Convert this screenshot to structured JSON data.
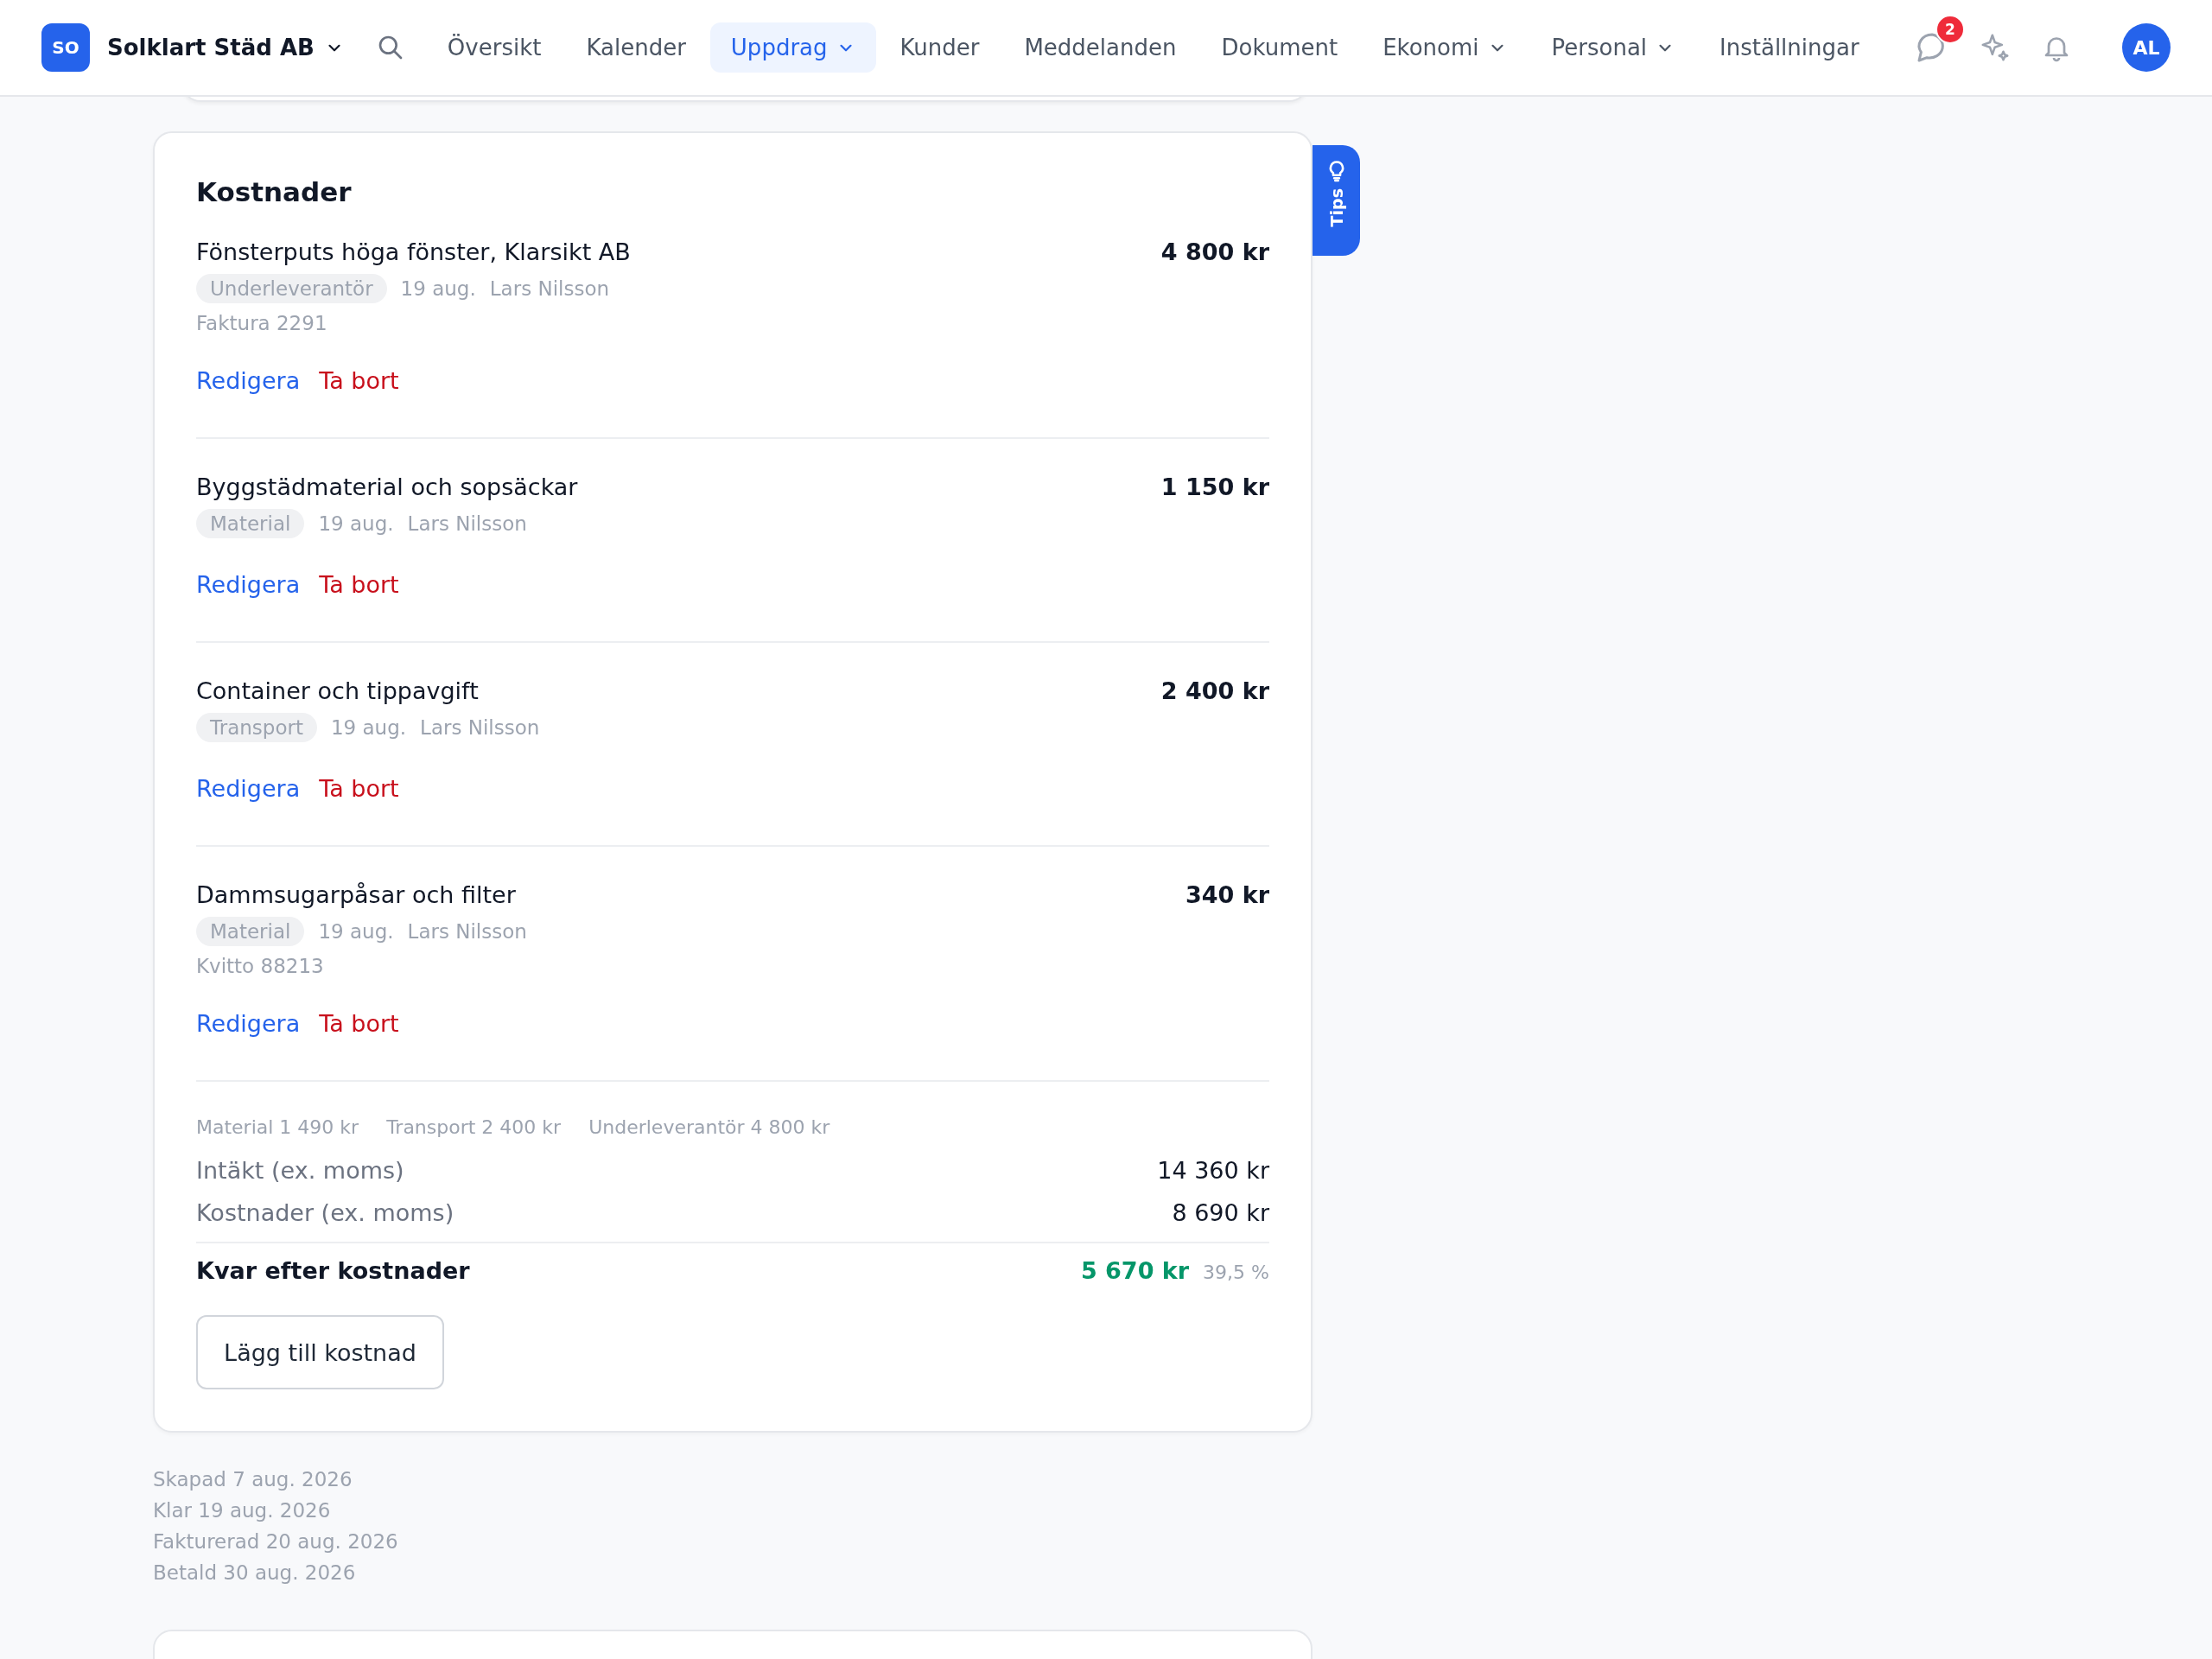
{
  "nav": {
    "logo": "SO",
    "company": "Solklart Städ AB",
    "items": [
      {
        "label": "Översikt",
        "selected": false,
        "dropdown": false
      },
      {
        "label": "Kalender",
        "selected": false,
        "dropdown": false
      },
      {
        "label": "Uppdrag",
        "selected": true,
        "dropdown": true
      },
      {
        "label": "Kunder",
        "selected": false,
        "dropdown": false
      },
      {
        "label": "Meddelanden",
        "selected": false,
        "dropdown": false
      },
      {
        "label": "Dokument",
        "selected": false,
        "dropdown": false
      },
      {
        "label": "Ekonomi",
        "selected": false,
        "dropdown": true
      },
      {
        "label": "Personal",
        "selected": false,
        "dropdown": true
      },
      {
        "label": "Inställningar",
        "selected": false,
        "dropdown": false
      }
    ],
    "message_badge": "2",
    "avatar": "AL"
  },
  "tips": "Tips",
  "costs": {
    "title": "Kostnader",
    "items": [
      {
        "title": "Fönsterputs höga fönster, Klarsikt AB",
        "amount": "4 800 kr",
        "category": "Underleverantör",
        "date": "19 aug.",
        "person": "Lars Nilsson",
        "note": "Faktura 2291",
        "edit": "Redigera",
        "delete": "Ta bort"
      },
      {
        "title": "Byggstädmaterial och sopsäckar",
        "amount": "1 150 kr",
        "category": "Material",
        "date": "19 aug.",
        "person": "Lars Nilsson",
        "edit": "Redigera",
        "delete": "Ta bort"
      },
      {
        "title": "Container och tippavgift",
        "amount": "2 400 kr",
        "category": "Transport",
        "date": "19 aug.",
        "person": "Lars Nilsson",
        "edit": "Redigera",
        "delete": "Ta bort"
      },
      {
        "title": "Dammsugarpåsar och filter",
        "amount": "340 kr",
        "category": "Material",
        "date": "19 aug.",
        "person": "Lars Nilsson",
        "note": "Kvitto 88213",
        "edit": "Redigera",
        "delete": "Ta bort"
      }
    ],
    "breakdown": [
      "Material 1 490 kr",
      "Transport 2 400 kr",
      "Underleverantör 4 800 kr"
    ],
    "rows": [
      {
        "label": "Intäkt (ex. moms)",
        "value": "14 360 kr"
      },
      {
        "label": "Kostnader (ex. moms)",
        "value": "8 690 kr"
      }
    ],
    "result": {
      "label": "Kvar efter kostnader",
      "value": "5 670 kr",
      "percent": "39,5 %"
    },
    "add_button": "Lägg till kostnad"
  },
  "timeline": [
    "Skapad 7 aug. 2026",
    "Klar 19 aug. 2026",
    "Fakturerad 20 aug. 2026",
    "Betald 30 aug. 2026"
  ]
}
